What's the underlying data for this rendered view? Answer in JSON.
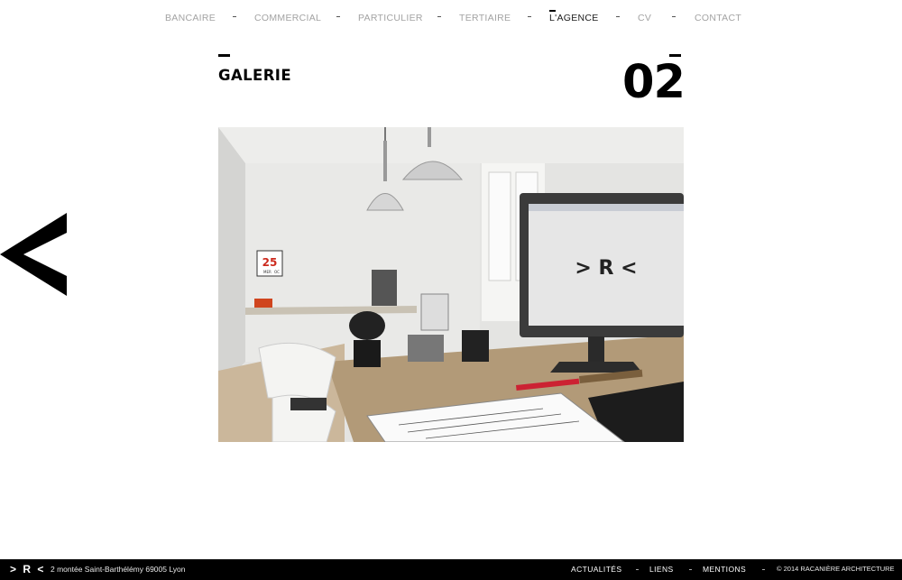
{
  "nav": {
    "items": [
      {
        "label": "BANCAIRE"
      },
      {
        "label": "COMMERCIAL"
      },
      {
        "label": "PARTICULIER"
      },
      {
        "label": "TERTIAIRE"
      },
      {
        "label": "L'AGENCE"
      },
      {
        "label": "CV"
      },
      {
        "label": "CONTACT"
      }
    ],
    "active": "L'AGENCE"
  },
  "section": {
    "title": "GALERIE",
    "page_number": "02"
  },
  "screen_logo": "> R <",
  "calendar": {
    "day": "25",
    "month": "MER",
    "extra": "OC"
  },
  "footer": {
    "logo": "> R <",
    "address": "2 montée Saint-Barthélémy 69005 Lyon",
    "links": [
      {
        "label": "ACTUALITÉS"
      },
      {
        "label": "LIENS"
      },
      {
        "label": "MENTIONS"
      }
    ],
    "copyright": "© 2014 RACANIÈRE ARCHITECTURE"
  },
  "colors": {
    "nav_inactive": "#a3a3a3",
    "nav_active": "#1a1a1a",
    "footer_bg": "#000000",
    "accent": "#000000"
  },
  "icons": {
    "prev": "chevron-left-icon"
  }
}
